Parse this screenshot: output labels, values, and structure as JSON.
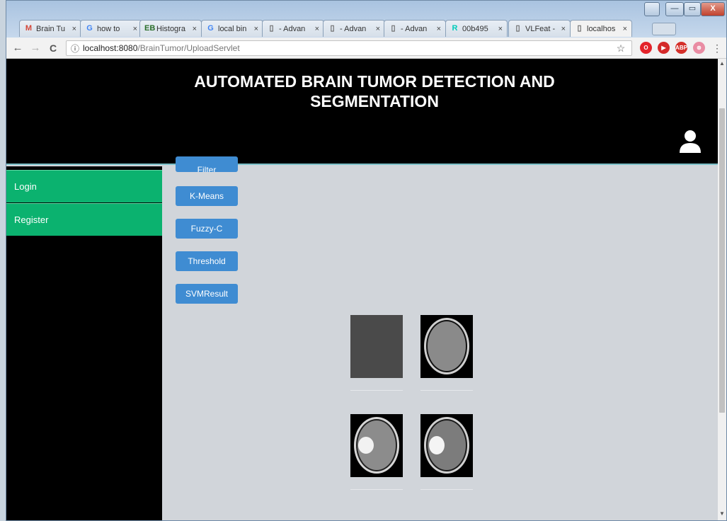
{
  "window": {
    "controls": {
      "user": "",
      "minimize": "—",
      "maximize": "▭",
      "close": "X"
    }
  },
  "tabs": [
    {
      "label": "Brain Tu",
      "icon": "gmail-icon",
      "glyph": "M",
      "color": "#d44638"
    },
    {
      "label": "how to",
      "icon": "google-icon",
      "glyph": "G",
      "color": "#4285f4"
    },
    {
      "label": "Histogra",
      "icon": "eb-icon",
      "glyph": "EB",
      "color": "#2a6e2a"
    },
    {
      "label": "local bin",
      "icon": "google-icon",
      "glyph": "G",
      "color": "#4285f4"
    },
    {
      "label": "- Advan",
      "icon": "page-icon",
      "glyph": "▯",
      "color": "#666"
    },
    {
      "label": "- Advan",
      "icon": "page-icon",
      "glyph": "▯",
      "color": "#666"
    },
    {
      "label": "- Advan",
      "icon": "page-icon",
      "glyph": "▯",
      "color": "#666"
    },
    {
      "label": "00b495",
      "icon": "researchgate-icon",
      "glyph": "R",
      "color": "#00ccbb"
    },
    {
      "label": "VLFeat -",
      "icon": "page-icon",
      "glyph": "▯",
      "color": "#666"
    },
    {
      "label": "localhos",
      "icon": "page-icon",
      "glyph": "▯",
      "color": "#666"
    }
  ],
  "tab_close": "×",
  "toolbar": {
    "back": "←",
    "forward": "→",
    "reload": "C",
    "info": "ⓘ",
    "url_host": "localhost:8080",
    "url_path": "/BrainTumor/UploadServlet",
    "star": "☆"
  },
  "extensions": [
    {
      "name": "opera-icon",
      "glyph": "O",
      "color": "#e3242b"
    },
    {
      "name": "ext-red-icon",
      "glyph": "▶",
      "color": "#d42a2a"
    },
    {
      "name": "adblock-icon",
      "glyph": "ABP",
      "color": "#d4302a"
    },
    {
      "name": "ext-pink-icon",
      "glyph": "⊗",
      "color": "#e98ca3"
    }
  ],
  "menu_glyph": "⋮",
  "page": {
    "title": "AUTOMATED BRAIN TUMOR DETECTION AND SEGMENTATION"
  },
  "sidebar": {
    "items": [
      {
        "label": "Login"
      },
      {
        "label": "Register"
      }
    ]
  },
  "buttons": {
    "filter": "Filter",
    "kmeans": "K-Means",
    "fuzzy": "Fuzzy-C",
    "threshold": "Threshold",
    "svm": "SVMResult"
  },
  "scroll": {
    "up": "▲",
    "down": "▼"
  }
}
